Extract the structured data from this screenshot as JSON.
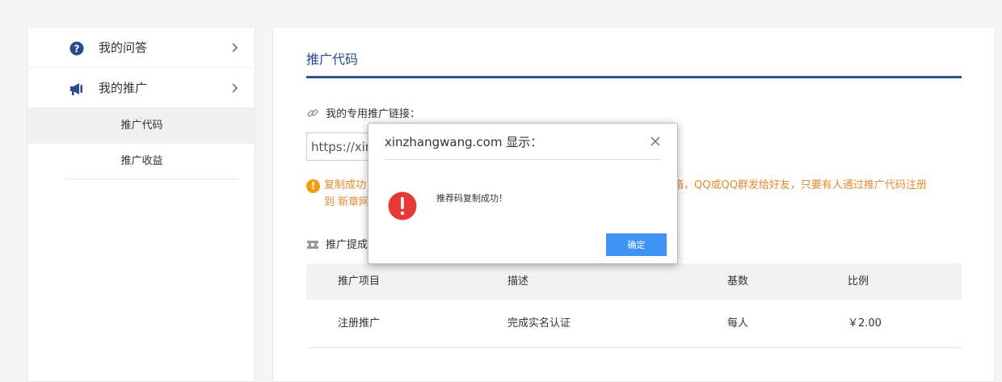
{
  "sidebar": {
    "items": [
      {
        "label": "我的问答",
        "icon": "question-circle-icon"
      },
      {
        "label": "我的推广",
        "icon": "megaphone-icon"
      }
    ],
    "sub_items": [
      {
        "label": "推广代码",
        "active": true
      },
      {
        "label": "推广收益",
        "active": false
      }
    ]
  },
  "main": {
    "title": "推广代码",
    "link_label": "我的专用推广链接：",
    "link_value": "https://xinz",
    "notice": {
      "line1_start": "复制成功",
      "line1_end": "邮箱，QQ或QQ群发给好友，只要有人通过推广代码注册",
      "line2": "到 新章网"
    },
    "promo_heading": "推广提成",
    "table": {
      "headers": [
        "推广项目",
        "描述",
        "基数",
        "比例"
      ],
      "rows": [
        [
          "注册推广",
          "完成实名认证",
          "每人",
          "￥2.00"
        ]
      ]
    }
  },
  "dialog": {
    "title": "xinzhangwang.com 显示：",
    "message": "推荐码复制成功！",
    "ok_label": "确定"
  },
  "colors": {
    "accent": "#2e5096",
    "notice": "#e58a2f",
    "button": "#3d94f6",
    "error": "#e53935"
  }
}
